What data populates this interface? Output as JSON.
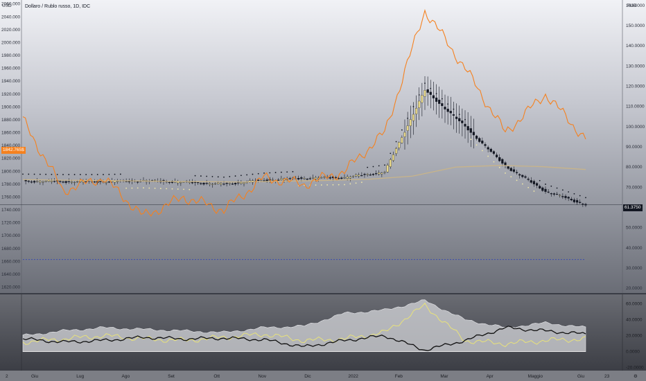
{
  "header": {
    "title": "Dollaro / Rublo russo, 1D, IDC",
    "left_unit": "USD",
    "right_unit": "RUB",
    "left_badge": "1842.765$",
    "right_badge": "61.3750"
  },
  "colors": {
    "gold_line": "#f5811f",
    "candle_up": "#e8d889",
    "candle_down": "#131722",
    "ma_long": "#c8b48a",
    "psar": "#131722",
    "psar_up": "#f0e8a8",
    "level_line": "#3a4bb0",
    "osc_black": "#111111",
    "osc_yellow": "#e8e27a",
    "osc_band": "#d4d5d9"
  },
  "left_axis": [
    "2060.000",
    "2040.000",
    "2020.000",
    "2000.000",
    "1980.000",
    "1960.000",
    "1940.000",
    "1920.000",
    "1900.000",
    "1880.000",
    "1860.000",
    "1840.000",
    "1820.000",
    "1800.000",
    "1780.000",
    "1760.000",
    "1740.000",
    "1720.000",
    "1700.000",
    "1680.000",
    "1660.000",
    "1640.000",
    "1620.000"
  ],
  "right_axis": [
    "160.0000",
    "150.0000",
    "140.0000",
    "130.0000",
    "120.0000",
    "110.0000",
    "100.0000",
    "90.0000",
    "80.0000",
    "70.0000",
    "60.0000",
    "50.0000",
    "40.0000",
    "30.0000",
    "20.0000"
  ],
  "osc_axis": [
    "60.0000",
    "40.0000",
    "20.0000",
    "0.0000",
    "-20.0000"
  ],
  "time_axis": [
    "Giu",
    "Lug",
    "Ago",
    "Set",
    "Ott",
    "Nov",
    "Dic",
    "2022",
    "Feb",
    "Mar",
    "Apr",
    "Maggio",
    "Giu"
  ],
  "time_axis_misc": {
    "left": "2",
    "right": "23",
    "far_right": "⚙"
  },
  "chart_data": [
    {
      "type": "line",
      "title": "Dollaro / Rublo russo, 1D, IDC",
      "x": [
        "Giu",
        "Lug",
        "Ago",
        "Set",
        "Ott",
        "Nov",
        "Dic",
        "2022",
        "Feb",
        "Mar",
        "Apr",
        "Maggio",
        "Giu"
      ],
      "series": [
        {
          "values": [
            1880,
            1770,
            1790,
            1730,
            1760,
            1740,
            1790,
            1780,
            1800,
            1860,
            2050,
            1960,
            1860,
            1920,
            1850
          ]
        },
        {
          "values": [
            73.0,
            72.8,
            72.8,
            73.2,
            72.5,
            71.5,
            73.5,
            74.5,
            74.8,
            77.5,
            118,
            100,
            80.5,
            68,
            61.37
          ]
        },
        {
          "values": [
            73.8,
            73.5,
            73.3,
            73.0,
            72.8,
            72.6,
            73.0,
            73.4,
            74.0,
            75.5,
            80.0,
            80.8,
            80.2,
            78.8
          ]
        }
      ],
      "left_ylim": [
        1612,
        2064
      ],
      "right_ylim": [
        18,
        162
      ],
      "reference_line": 1663,
      "grid": false
    },
    {
      "type": "line",
      "x": [
        "Giu",
        "Lug",
        "Ago",
        "Set",
        "Ott",
        "Nov",
        "Dic",
        "2022",
        "Feb",
        "Mar",
        "Apr",
        "Maggio",
        "Giu"
      ],
      "series": [
        {
          "values": [
            16,
            12,
            14,
            18,
            16,
            17,
            15,
            6,
            14,
            20,
            2,
            14,
            30,
            26,
            22
          ]
        },
        {
          "values": [
            12,
            16,
            20,
            16,
            14,
            18,
            22,
            14,
            16,
            24,
            58,
            14,
            10,
            14,
            16
          ]
        },
        {
          "values": [
            20,
            26,
            30,
            28,
            26,
            24,
            30,
            32,
            48,
            52,
            64,
            40,
            30,
            36,
            30
          ]
        }
      ],
      "ylim": [
        -22,
        70
      ]
    }
  ]
}
